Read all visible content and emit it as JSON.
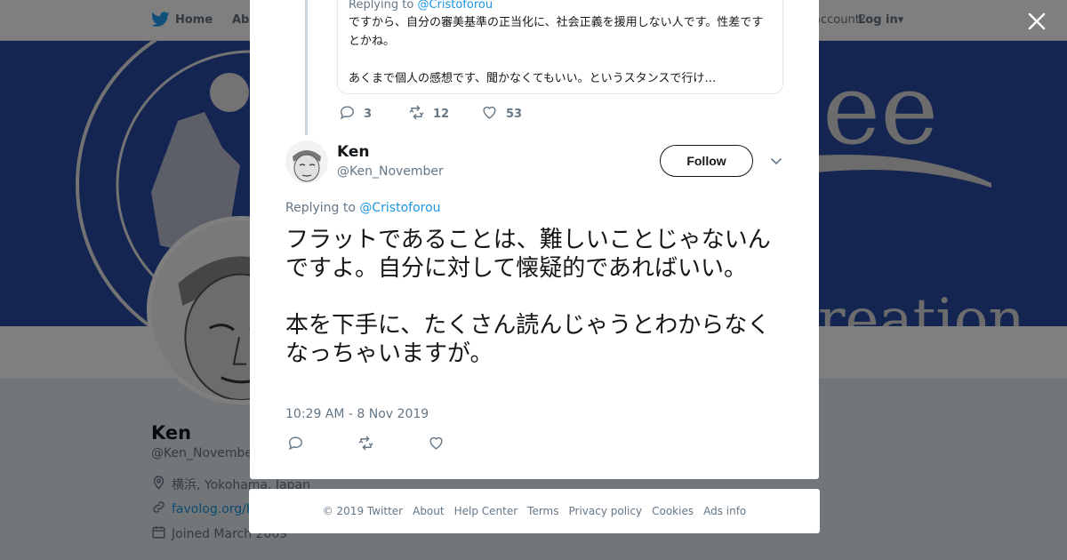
{
  "topnav": {
    "home_label": "Home",
    "about_label": "Abo",
    "account_label": "account?",
    "login_label": "Log in"
  },
  "profile": {
    "name": "Ken",
    "handle": "@Ken_November",
    "location": "横浜, Yokohama, Japan",
    "link": "favolog.org/Ke",
    "joined": "Joined March 2009",
    "ads_info": "Ads info"
  },
  "quoted_tweet": {
    "replying_prefix": "Replying to ",
    "replying_to": "@Cristoforou",
    "text": "ですから、自分の審美基準の正当化に、社会正義を援用しない人です。性差ですとかね。\n\nあくまで個人の感想です、聞かなくてもいい。というスタンスで行け…",
    "replies": "3",
    "retweets": "12",
    "likes": "53"
  },
  "tweet": {
    "name": "Ken",
    "handle": "@Ken_November",
    "follow_label": "Follow",
    "replying_prefix": "Replying to ",
    "replying_to": "@Cristoforou",
    "text": "フラットであることは、難しいことじゃないんですよ。自分に対して懐疑的であればいい。\n\n本を下手に、たくさん読んじゃうとわからなくなっちゃいますが。",
    "timestamp": "10:29 AM - 8 Nov 2019"
  },
  "footer": {
    "copyright": "© 2019 Twitter",
    "links": [
      "About",
      "Help Center",
      "Terms",
      "Privacy policy",
      "Cookies",
      "Ads info"
    ]
  },
  "colors": {
    "twitter_blue": "#1da1f2",
    "link_blue": "#1b95e0",
    "banner_blue": "#2b4aa4",
    "text_primary": "#14171a",
    "text_secondary": "#657786"
  },
  "icons": {
    "brand": "twitter-bird-icon",
    "close": "close-icon",
    "reply": "reply-icon",
    "retweet": "retweet-icon",
    "like": "heart-icon",
    "more": "chevron-down-icon"
  }
}
